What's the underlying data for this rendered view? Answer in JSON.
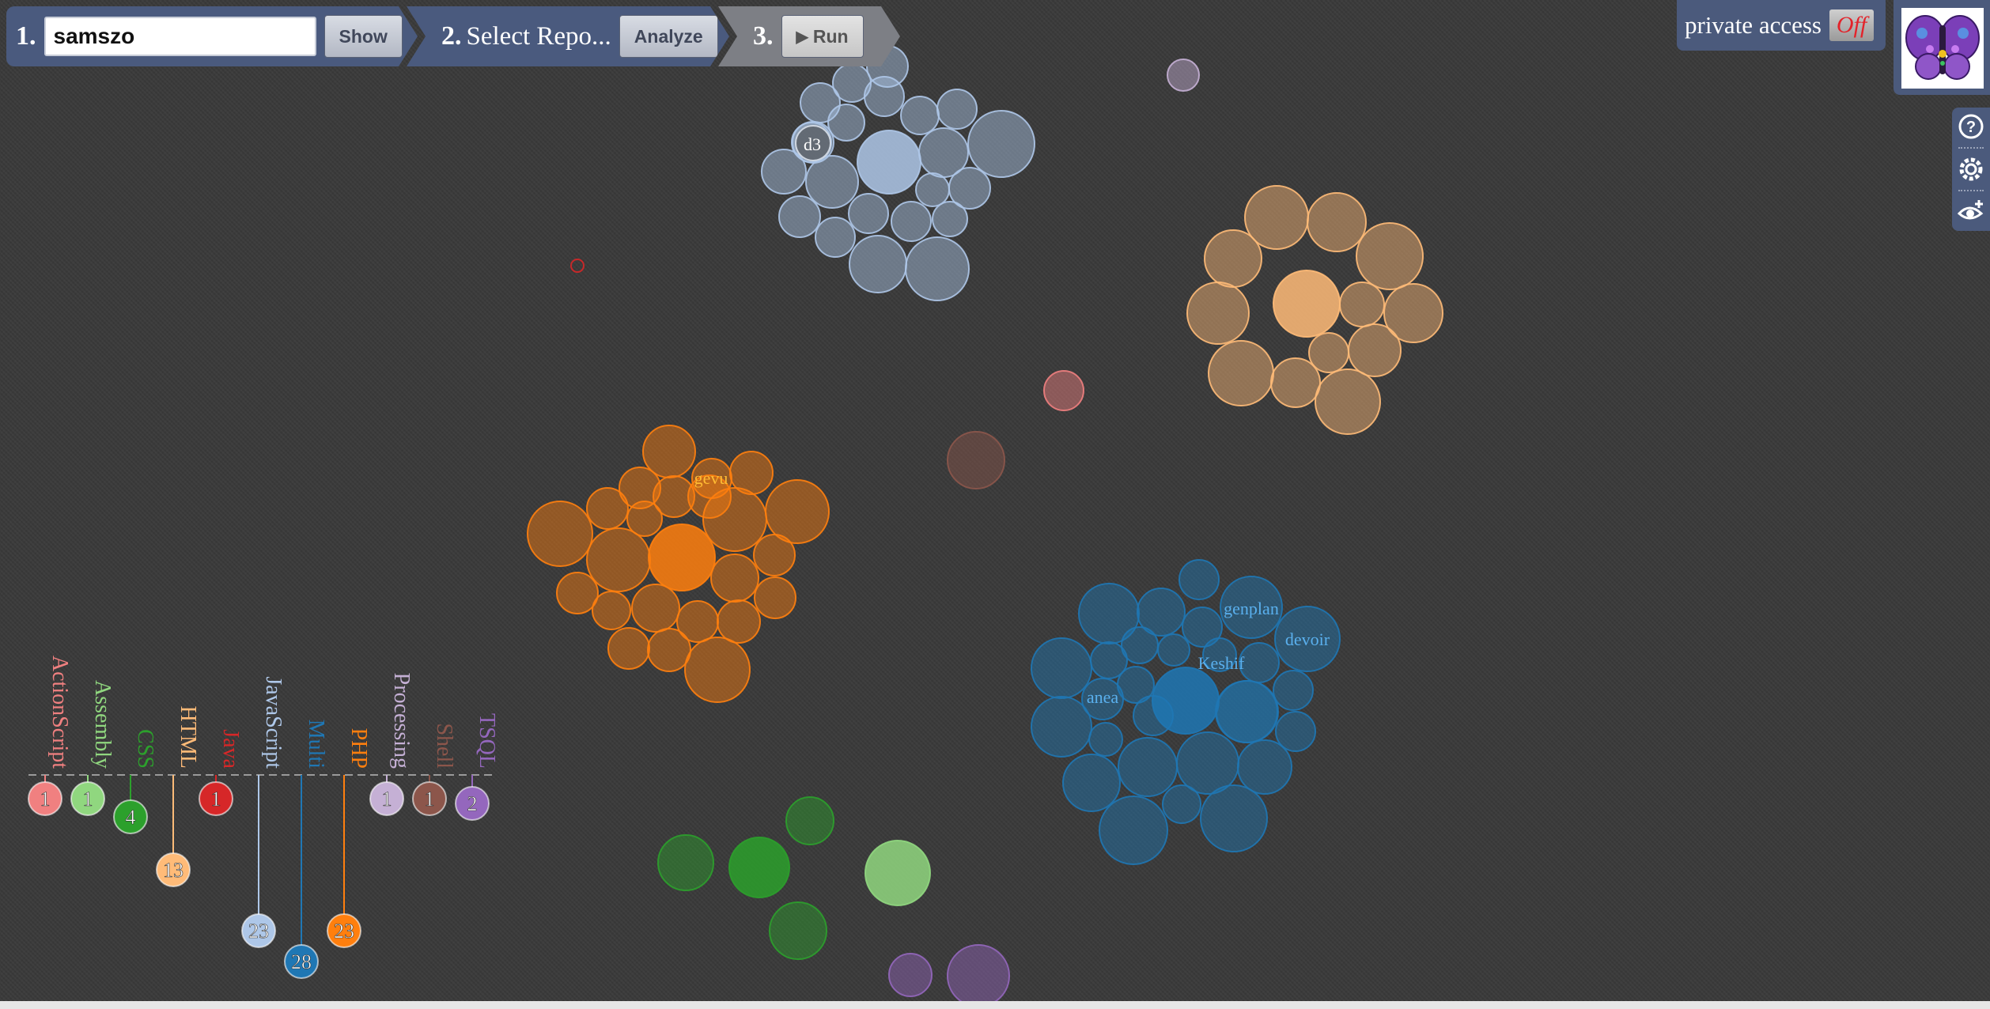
{
  "steps": {
    "step1": {
      "number": "1.",
      "username": "samszo",
      "show_label": "Show"
    },
    "step2": {
      "number": "2.",
      "label": "Select Repo...",
      "analyze_label": "Analyze"
    },
    "step3": {
      "number": "3.",
      "run_label": "Run"
    }
  },
  "private_access": {
    "label": "private access",
    "state": "Off"
  },
  "tools": [
    "help-icon",
    "settings-icon",
    "eye-plus-icon"
  ],
  "legend": [
    {
      "name": "ActionScript",
      "count": "1",
      "color": "#f08080"
    },
    {
      "name": "Assembly",
      "count": "1",
      "color": "#90d77f"
    },
    {
      "name": "CSS",
      "count": "4",
      "color": "#2ca02c"
    },
    {
      "name": "HTML",
      "count": "13",
      "color": "#ffbb78"
    },
    {
      "name": "Java",
      "count": "1",
      "color": "#d62728"
    },
    {
      "name": "JavaScript",
      "count": "23",
      "color": "#aec7e8"
    },
    {
      "name": "Multi",
      "count": "28",
      "color": "#1f77b4"
    },
    {
      "name": "PHP",
      "count": "23",
      "color": "#ff7f0e"
    },
    {
      "name": "Processing",
      "count": "1",
      "color": "#c5b0d5"
    },
    {
      "name": "Shell",
      "count": "1",
      "color": "#8c564b"
    },
    {
      "name": "TSQL",
      "count": "2",
      "color": "#9467bd"
    }
  ],
  "repo_labels": [
    "d3",
    "gevu",
    "genplan",
    "devoir",
    "Keshif",
    "anea"
  ]
}
